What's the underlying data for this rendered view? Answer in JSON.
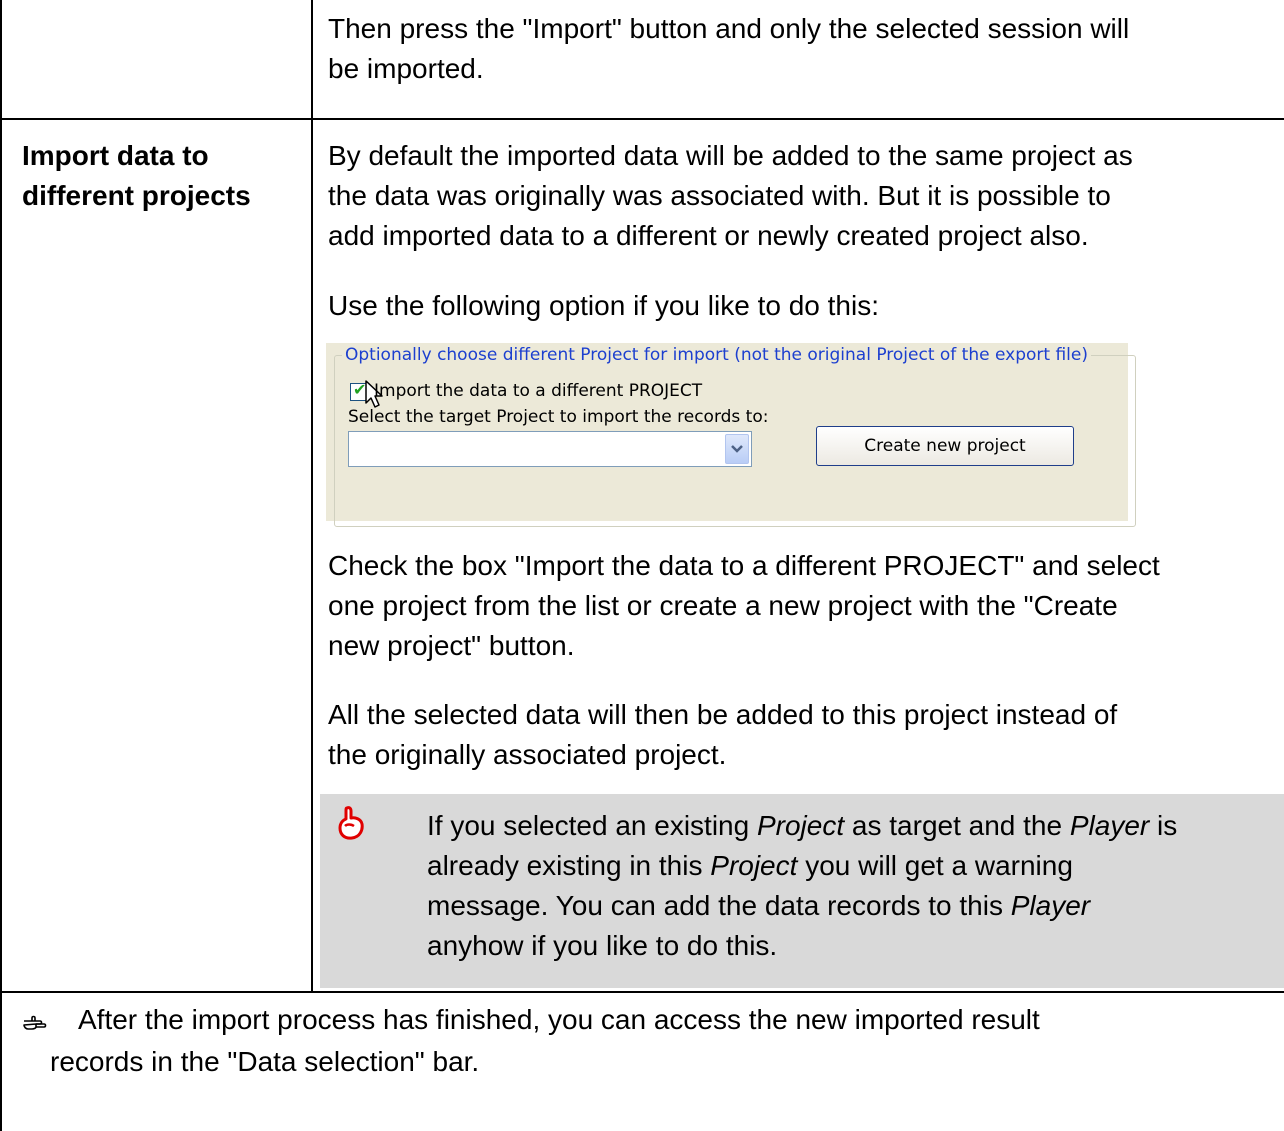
{
  "row1": {
    "text_line1": "Then press the \"Import\" button and only the selected session will",
    "text_line2": "be imported."
  },
  "row2": {
    "label_line1": "Import data to",
    "label_line2": "different projects",
    "para1_line1": "By default the imported data will be added to the same project as",
    "para1_line2": "the data was originally was associated with. But it is possible to",
    "para1_line3": "add imported data to a different or newly created project also.",
    "para2": "Use the following option if you like to do this:",
    "panel": {
      "group_legend": "Optionally choose different Project for import (not the original Project of the export file)",
      "checkbox_label": "Import the data to a different PROJECT",
      "checkbox_checked": true,
      "select_label": "Select the target Project to import the records to:",
      "combo_value": "",
      "create_button": "Create new project"
    },
    "para3_line1": "Check the box \"Import the data to a different PROJECT\" and select",
    "para3_line2": "one project from the list or create a new project with the \"Create",
    "para3_line3": "new project\" button.",
    "para4_line1": "All the selected data will then be added to this project instead of",
    "para4_line2": "the originally associated project.",
    "note": {
      "icon": "pointing-hand-icon",
      "line1_a": "If you selected an existing ",
      "line1_b": "Project",
      "line1_c": " as target and the ",
      "line1_d": "Player",
      "line1_e": " is",
      "line2_a": "already existing in this ",
      "line2_b": "Project",
      "line2_c": " you will get a warning",
      "line3_a": "message. You can add the data records to this ",
      "line3_b": "Player",
      "line4": "anyhow if you like to do this."
    }
  },
  "footer": {
    "icon": "pointing-finger-icon",
    "line1": "After the import process has finished, you can access the new imported result",
    "line2": "records in the \"Data selection\" bar."
  },
  "colors": {
    "note_background": "#d9d9d9",
    "legend_text": "#1c3fcf",
    "note_icon": "#e00000"
  }
}
